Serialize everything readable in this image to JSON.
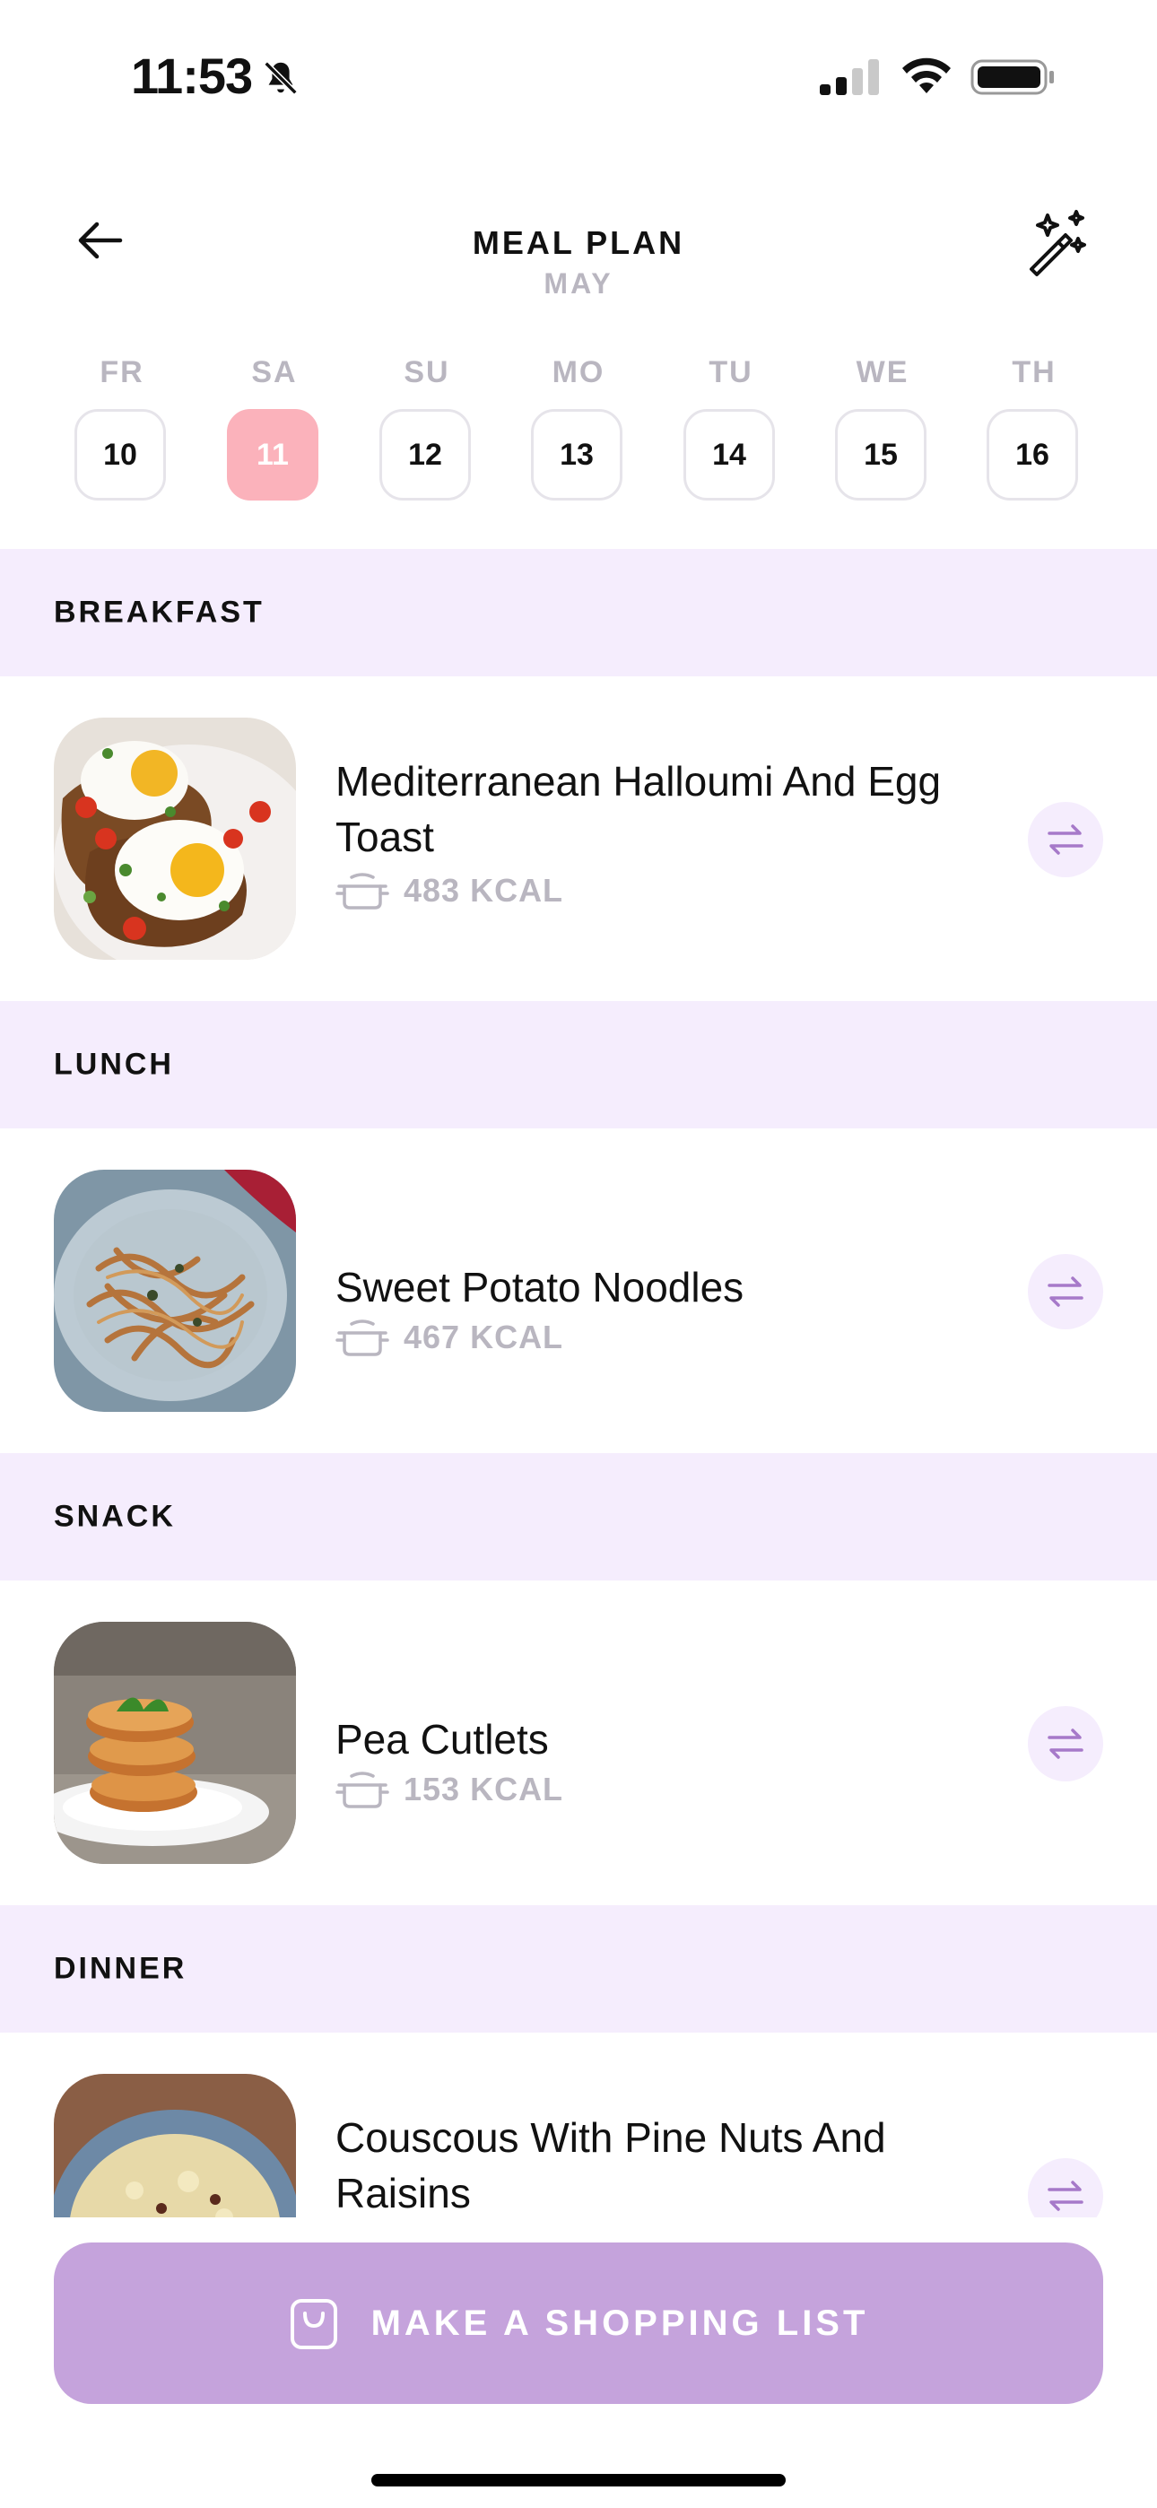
{
  "status_bar": {
    "time": "11:53",
    "icons": [
      "bell-slash-icon",
      "cellular-signal-icon",
      "wifi-icon",
      "battery-icon"
    ]
  },
  "header": {
    "title": "MEAL PLAN",
    "month": "MAY",
    "back_icon": "arrow-left-icon",
    "magic_icon": "magic-wand-sparkles-icon"
  },
  "days": [
    {
      "name": "FR",
      "date": "10",
      "active": false
    },
    {
      "name": "SA",
      "date": "11",
      "active": true
    },
    {
      "name": "SU",
      "date": "12",
      "active": false
    },
    {
      "name": "MO",
      "date": "13",
      "active": false
    },
    {
      "name": "TU",
      "date": "14",
      "active": false
    },
    {
      "name": "WE",
      "date": "15",
      "active": false
    },
    {
      "name": "TH",
      "date": "16",
      "active": false
    }
  ],
  "meals": [
    {
      "section": "BREAKFAST",
      "name": "Mediterranean Halloumi And Egg Toast",
      "kcal": "483 KCAL",
      "image": "egg-toast-photo"
    },
    {
      "section": "LUNCH",
      "name": "Sweet Potato Noodles",
      "kcal": "467 KCAL",
      "image": "noodles-photo"
    },
    {
      "section": "SNACK",
      "name": "Pea Cutlets",
      "kcal": "153 KCAL",
      "image": "pea-cutlets-photo"
    },
    {
      "section": "DINNER",
      "name": "Couscous With Pine Nuts And Raisins",
      "kcal": "",
      "image": "couscous-photo"
    }
  ],
  "cta": {
    "label": "MAKE A SHOPPING LIST",
    "icon": "shopping-bag-icon"
  },
  "colors": {
    "accent_pink": "#fbb2bb",
    "section_bg": "#f5edfd",
    "cta_bg": "#c5a3dc",
    "swap_icon": "#a679c9",
    "muted_text": "#b9b6c0"
  }
}
